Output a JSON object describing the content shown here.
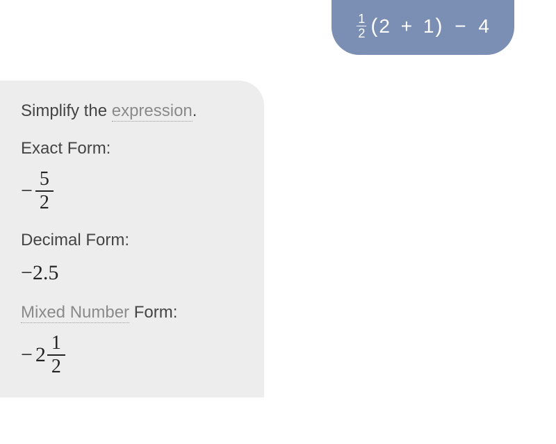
{
  "chart_data": null,
  "query": {
    "fraction_num": "1",
    "fraction_den": "2",
    "paren_open": "(",
    "inner_a": "2",
    "plus": "+",
    "inner_b": "1",
    "paren_close": ")",
    "minus": "−",
    "tail": "4"
  },
  "answer": {
    "intro_prefix": "Simplify the ",
    "intro_term": "expression",
    "intro_suffix": ".",
    "exact_label": "Exact Form:",
    "exact_minus": "−",
    "exact_num": "5",
    "exact_den": "2",
    "decimal_label": "Decimal Form:",
    "decimal_value": "−2.5",
    "mixed_label_term": "Mixed Number",
    "mixed_label_suffix": " Form:",
    "mixed_minus": "−",
    "mixed_whole": "2",
    "mixed_num": "1",
    "mixed_den": "2"
  }
}
